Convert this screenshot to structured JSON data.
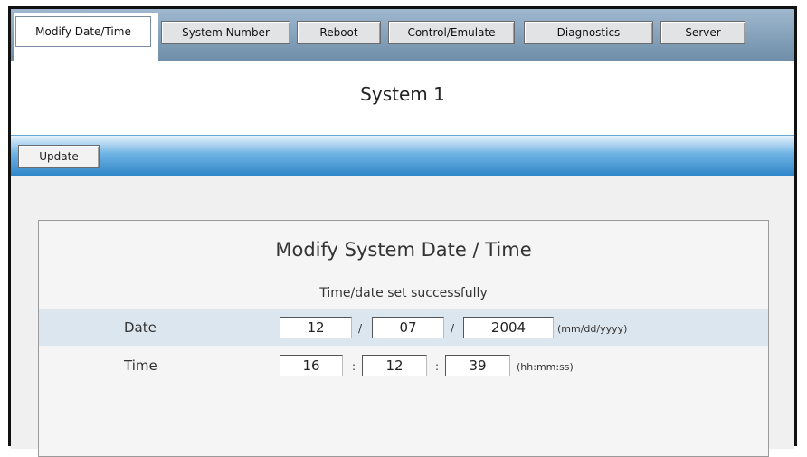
{
  "tabs": [
    {
      "label": "Modify Date/Time",
      "active": true
    },
    {
      "label": "System Number",
      "active": false
    },
    {
      "label": "Reboot",
      "active": false
    },
    {
      "label": "Control/Emulate",
      "active": false
    },
    {
      "label": "Diagnostics",
      "active": false
    },
    {
      "label": "Server",
      "active": false
    }
  ],
  "page_title": "System 1",
  "toolbar": {
    "update_label": "Update"
  },
  "panel": {
    "title": "Modify System Date / Time",
    "status": "Time/date set successfully",
    "date": {
      "label": "Date",
      "month": "12",
      "day": "07",
      "year": "2004",
      "separator": "/",
      "hint": "(mm/dd/yyyy)"
    },
    "time": {
      "label": "Time",
      "hour": "16",
      "minute": "12",
      "second": "39",
      "separator": ":",
      "hint": "(hh:mm:ss)"
    }
  },
  "colors": {
    "tabbar": "#7f9db8",
    "update_bar": "#2f86c8",
    "date_row": "#dce6ef"
  }
}
